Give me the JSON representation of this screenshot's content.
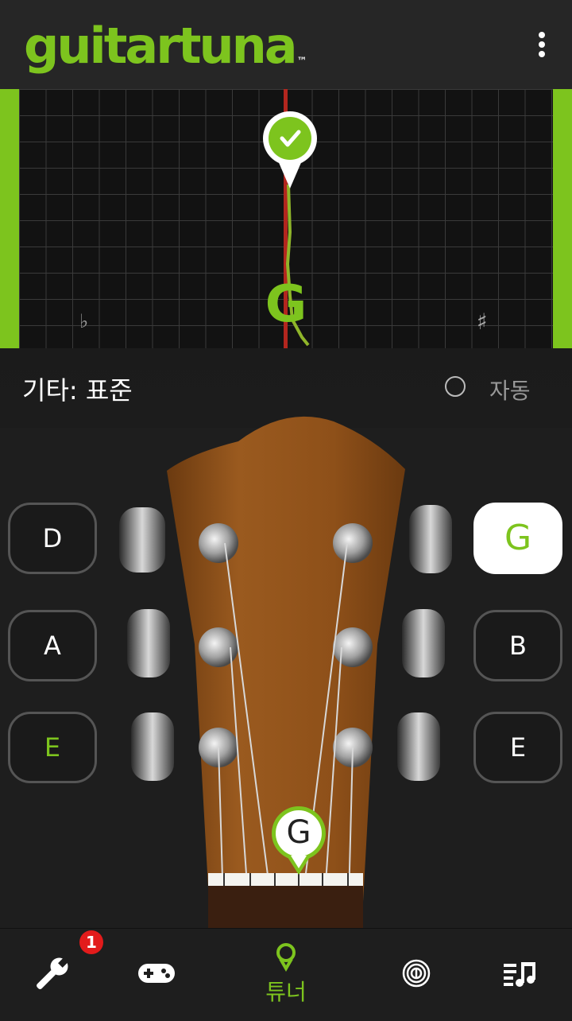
{
  "app": {
    "logo_text": "guitartuna",
    "logo_tm": "™"
  },
  "tuner": {
    "current_note": "G",
    "flat_symbol": "♭",
    "sharp_symbol": "♯"
  },
  "tuning": {
    "label": "기타: 표준",
    "auto_label": "자동",
    "auto_enabled": false
  },
  "strings": {
    "left": [
      {
        "note": "D"
      },
      {
        "note": "A"
      },
      {
        "note": "E"
      }
    ],
    "right": [
      {
        "note": "G"
      },
      {
        "note": "B"
      },
      {
        "note": "E"
      }
    ]
  },
  "selected_string": "G",
  "nav": {
    "badge_count": "1",
    "tuner_label": "튜너"
  },
  "colors": {
    "accent": "#7dc41e",
    "badge": "#e21b1b",
    "needle": "#b3261e"
  }
}
